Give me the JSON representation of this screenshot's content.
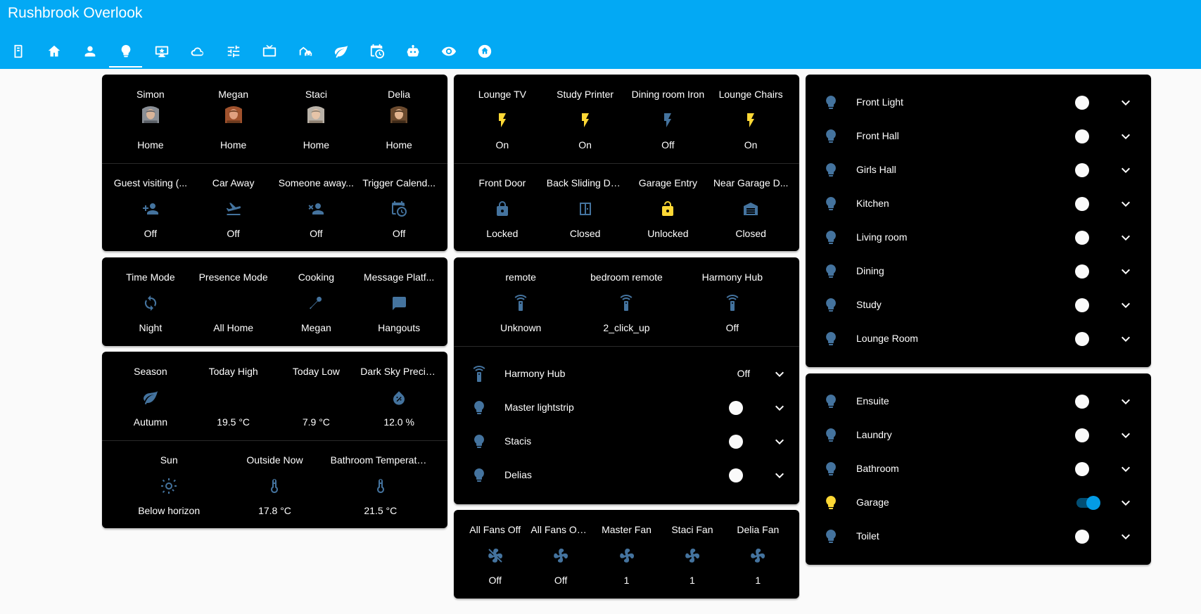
{
  "app_title": "Rushbrook Overlook",
  "tabs": [
    {
      "icon": "book-icon"
    },
    {
      "icon": "home-icon"
    },
    {
      "icon": "account-icon"
    },
    {
      "icon": "lightbulb-icon",
      "active": true
    },
    {
      "icon": "monitor-star-icon"
    },
    {
      "icon": "cloud-icon"
    },
    {
      "icon": "tune-icon"
    },
    {
      "icon": "television-icon"
    },
    {
      "icon": "car-house-icon"
    },
    {
      "icon": "leaf-icon"
    },
    {
      "icon": "calendar-clock-icon"
    },
    {
      "icon": "robot-icon"
    },
    {
      "icon": "eye-icon"
    },
    {
      "icon": "home-circle-icon"
    }
  ],
  "people": [
    {
      "name": "Simon",
      "state": "Home"
    },
    {
      "name": "Megan",
      "state": "Home"
    },
    {
      "name": "Staci",
      "state": "Home"
    },
    {
      "name": "Delia",
      "state": "Home"
    }
  ],
  "automations": [
    {
      "name": "Guest visiting (...",
      "icon": "account-plus-icon",
      "state": "Off"
    },
    {
      "name": "Car Away",
      "icon": "airplane-takeoff-icon",
      "state": "Off"
    },
    {
      "name": "Someone away...",
      "icon": "account-remove-icon",
      "state": "Off"
    },
    {
      "name": "Trigger Calend...",
      "icon": "calendar-clock-icon",
      "state": "Off"
    }
  ],
  "modes": [
    {
      "name": "Time Mode",
      "icon": "sync-icon",
      "state": "Night"
    },
    {
      "name": "Presence Mode",
      "icon": "",
      "state": "All Home"
    },
    {
      "name": "Cooking",
      "icon": "pin-icon",
      "state": "Megan"
    },
    {
      "name": "Message Platf...",
      "icon": "message-icon",
      "state": "Hangouts"
    }
  ],
  "weather": [
    {
      "name": "Season",
      "icon": "leaf-icon",
      "state": "Autumn"
    },
    {
      "name": "Today High",
      "icon": "",
      "state": "19.5 °C"
    },
    {
      "name": "Today Low",
      "icon": "",
      "state": "7.9 °C"
    },
    {
      "name": "Dark Sky Precip...",
      "icon": "water-percent-icon",
      "state": "12.0 %"
    }
  ],
  "sensors": [
    {
      "name": "Sun",
      "icon": "sun-icon",
      "state": "Below horizon"
    },
    {
      "name": "Outside Now",
      "icon": "thermometer-icon",
      "state": "17.8 °C"
    },
    {
      "name": "Bathroom Temperature",
      "icon": "thermometer-icon",
      "state": "21.5 °C"
    }
  ],
  "switches": [
    {
      "name": "Lounge TV",
      "state": "On",
      "on": true
    },
    {
      "name": "Study Printer",
      "state": "On",
      "on": true
    },
    {
      "name": "Dining room Iron",
      "state": "Off",
      "on": false
    },
    {
      "name": "Lounge Chairs",
      "state": "On",
      "on": true
    }
  ],
  "doors": [
    {
      "name": "Front Door",
      "icon": "lock-icon",
      "state": "Locked"
    },
    {
      "name": "Back Sliding Do...",
      "icon": "door-sliding-icon",
      "state": "Closed"
    },
    {
      "name": "Garage Entry",
      "icon": "lock-open-icon",
      "state": "Unlocked"
    },
    {
      "name": "Near Garage D...",
      "icon": "garage-icon",
      "state": "Closed"
    }
  ],
  "remotes": [
    {
      "name": "remote",
      "icon": "remote-icon",
      "state": "Unknown"
    },
    {
      "name": "bedroom remote",
      "icon": "remote-icon",
      "state": "2_click_up"
    },
    {
      "name": "Harmony Hub",
      "icon": "remote-icon",
      "state": "Off"
    }
  ],
  "remote_entities": [
    {
      "name": "Harmony Hub",
      "type": "text",
      "state": "Off",
      "icon": "remote-icon"
    },
    {
      "name": "Master lightstrip",
      "type": "toggle",
      "on": false,
      "icon": "lightbulb-icon"
    },
    {
      "name": "Stacis",
      "type": "toggle",
      "on": false,
      "icon": "lightbulb-icon"
    },
    {
      "name": "Delias",
      "type": "toggle",
      "on": false,
      "icon": "lightbulb-icon"
    }
  ],
  "fans": [
    {
      "name": "All Fans Off",
      "state": "Off",
      "icon": "fan-off-icon"
    },
    {
      "name": "All Fans On ...",
      "state": "Off",
      "icon": "fan-icon"
    },
    {
      "name": "Master Fan",
      "state": "1",
      "icon": "fan-icon"
    },
    {
      "name": "Staci Fan",
      "state": "1",
      "icon": "fan-icon"
    },
    {
      "name": "Delia Fan",
      "state": "1",
      "icon": "fan-icon"
    }
  ],
  "lights_main": [
    {
      "name": "Front Light",
      "on": false
    },
    {
      "name": "Front Hall",
      "on": false
    },
    {
      "name": "Girls Hall",
      "on": false
    },
    {
      "name": "Kitchen",
      "on": false
    },
    {
      "name": "Living room",
      "on": false
    },
    {
      "name": "Dining",
      "on": false
    },
    {
      "name": "Study",
      "on": false
    },
    {
      "name": "Lounge Room",
      "on": false
    }
  ],
  "lights_other": [
    {
      "name": "Ensuite",
      "on": false
    },
    {
      "name": "Laundry",
      "on": false
    },
    {
      "name": "Bathroom",
      "on": false
    },
    {
      "name": "Garage",
      "on": true
    },
    {
      "name": "Toilet",
      "on": false
    }
  ],
  "colors": {
    "header": "#03a9f4",
    "icon_blue": "#44739e",
    "icon_yellow": "#fdd835",
    "toggle_on": "#039be5"
  }
}
